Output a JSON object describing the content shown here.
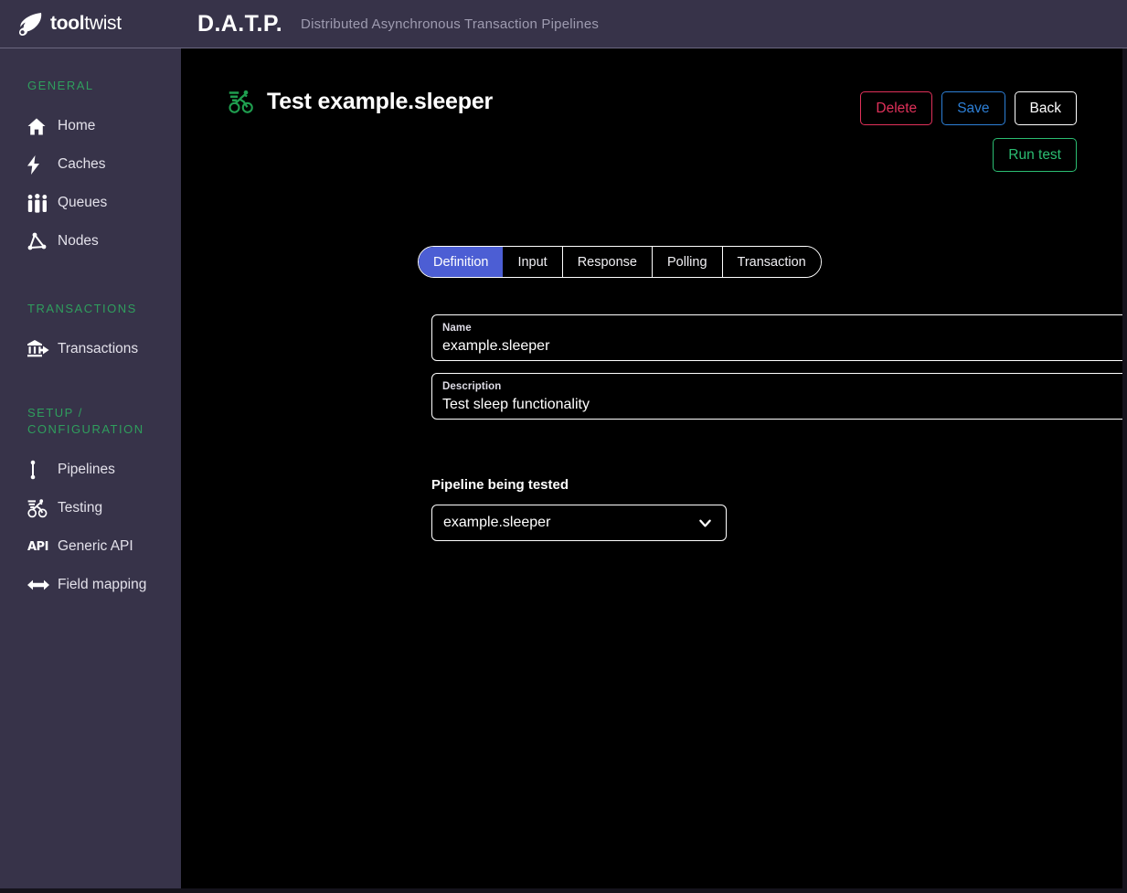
{
  "header": {
    "logo_name": "tooltwist-logo",
    "logo_bold": "tool",
    "logo_light": "twist",
    "abbr": "D.A.T.P.",
    "subtitle": "Distributed Asynchronous Transaction Pipelines"
  },
  "sidebar": {
    "sections": [
      {
        "title": "GENERAL",
        "items": [
          {
            "label": "Home",
            "icon": "home-icon"
          },
          {
            "label": "Caches",
            "icon": "lightning-bolt-icon"
          },
          {
            "label": "Queues",
            "icon": "people-queue-icon"
          },
          {
            "label": "Nodes",
            "icon": "nodes-network-icon"
          }
        ]
      },
      {
        "title": "TRANSACTIONS",
        "items": [
          {
            "label": "Transactions",
            "icon": "bank-transfer-icon"
          }
        ]
      },
      {
        "title": "SETUP /\nCONFIGURATION",
        "items": [
          {
            "label": "Pipelines",
            "icon": "pipeline-icon"
          },
          {
            "label": "Testing",
            "icon": "cyclist-icon"
          },
          {
            "label": "Generic API",
            "icon": "api-icon"
          },
          {
            "label": "Field mapping",
            "icon": "left-right-arrow-icon"
          }
        ]
      }
    ]
  },
  "page": {
    "title_icon": "cyclist-icon",
    "title": "Test example.sleeper",
    "actions": [
      {
        "label": "Delete",
        "name": "delete-button",
        "color": "#e0315a"
      },
      {
        "label": "Save",
        "name": "save-button",
        "color": "#2d7fd6"
      },
      {
        "label": "Back",
        "name": "back-button",
        "color": "#ffffff"
      }
    ],
    "run_test_label": "Run test"
  },
  "tabs": [
    {
      "label": "Definition",
      "active": true
    },
    {
      "label": "Input",
      "active": false
    },
    {
      "label": "Response",
      "active": false
    },
    {
      "label": "Polling",
      "active": false
    },
    {
      "label": "Transaction",
      "active": false
    }
  ],
  "form": {
    "name_label": "Name",
    "name_value": "example.sleeper",
    "description_label": "Description",
    "description_value": "Test sleep functionality"
  },
  "pipeline": {
    "section_label": "Pipeline being tested",
    "selected": "example.sleeper"
  },
  "colors": {
    "chrome": "#373349",
    "canvas": "#000000",
    "section_heading": "#2f9e5d",
    "accent_tab": "#4c5ed4",
    "accent_green": "#2bbd72",
    "accent_red": "#e0315a",
    "accent_blue": "#2d7fd6"
  }
}
